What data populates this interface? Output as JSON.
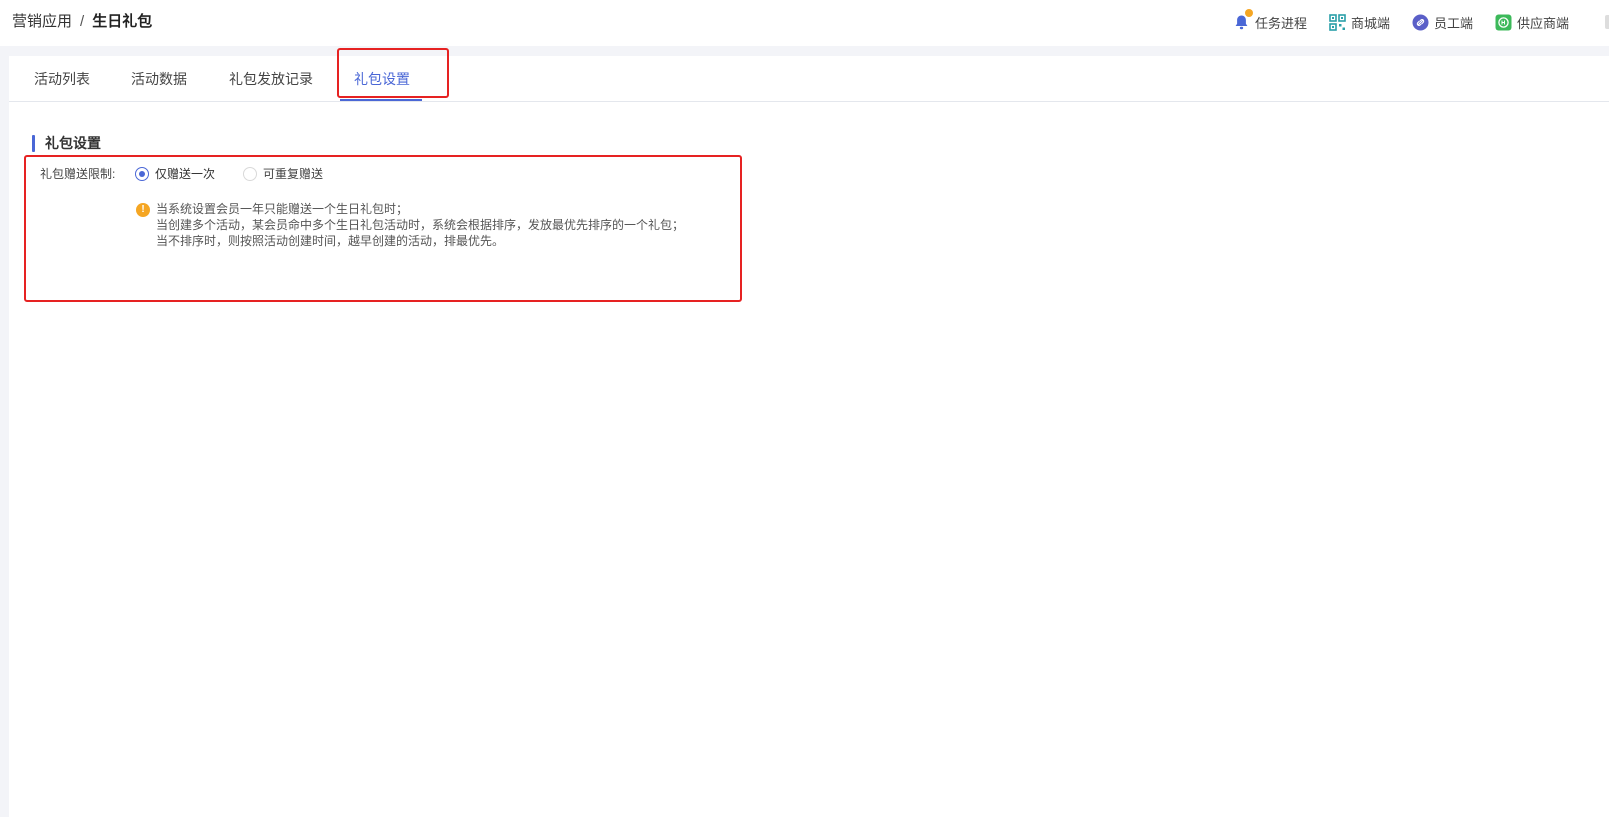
{
  "breadcrumb": {
    "parent": "营销应用",
    "separator": "/",
    "current": "生日礼包"
  },
  "top_links": [
    {
      "label": "任务进程",
      "icon": "bell-icon",
      "has_badge": true
    },
    {
      "label": "商城端",
      "icon": "qrcode-icon"
    },
    {
      "label": "员工端",
      "icon": "link-icon"
    },
    {
      "label": "供应商端",
      "icon": "supplier-icon"
    }
  ],
  "tabs": [
    {
      "label": "活动列表"
    },
    {
      "label": "活动数据"
    },
    {
      "label": "礼包发放记录"
    },
    {
      "label": "礼包设置",
      "active": true
    }
  ],
  "section": {
    "title": "礼包设置"
  },
  "form": {
    "limit_label": "礼包赠送限制:",
    "options": [
      {
        "label": "仅赠送一次",
        "checked": true
      },
      {
        "label": "可重复赠送",
        "checked": false
      }
    ],
    "notice_icon": "warning-icon",
    "notice_lines": [
      "当系统设置会员一年只能赠送一个生日礼包时；",
      "当创建多个活动，某会员命中多个生日礼包活动时，系统会根据排序，发放最优先排序的一个礼包；",
      "当不排序时，则按照活动创建时间，越早创建的活动，排最优先。"
    ]
  },
  "colors": {
    "accent": "#4a67d6",
    "warning": "#f5a623",
    "highlight": "#e62222"
  }
}
